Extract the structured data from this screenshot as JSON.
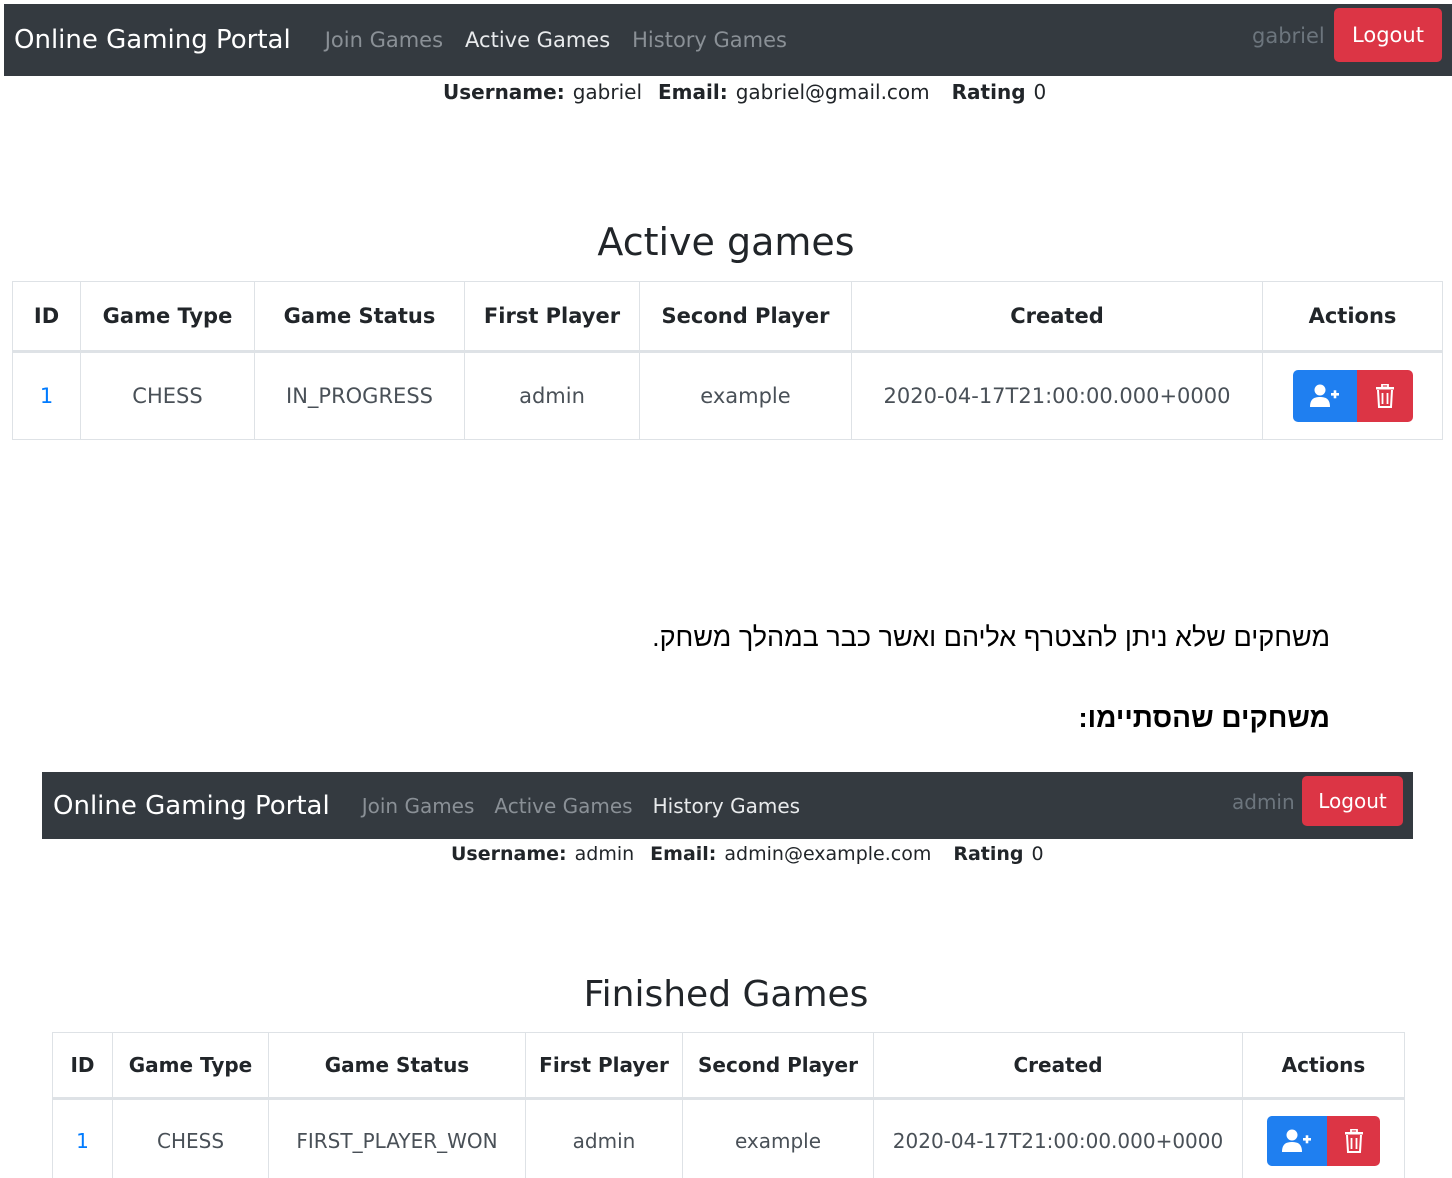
{
  "screen1": {
    "navbar": {
      "brand": "Online Gaming Portal",
      "links": [
        "Join Games",
        "Active Games",
        "History Games"
      ],
      "user": "gabriel",
      "logout": "Logout"
    },
    "profile": {
      "username_label": "Username:",
      "username": "gabriel",
      "email_label": "Email:",
      "email": "gabriel@gmail.com",
      "rating_label": "Rating",
      "rating": "0"
    },
    "heading": "Active games",
    "table": {
      "headers": [
        "ID",
        "Game Type",
        "Game Status",
        "First Player",
        "Second Player",
        "Created",
        "Actions"
      ],
      "rows": [
        {
          "id": "1",
          "type": "CHESS",
          "status": "IN_PROGRESS",
          "first": "admin",
          "second": "example",
          "created": "2020-04-17T21:00:00.000+0000"
        }
      ]
    }
  },
  "caption": "משחקים שלא ניתן להצטרף אליהם ואשר כבר במהלך משחק.",
  "section_heading": "משחקים שהסתיימו:",
  "screen2": {
    "navbar": {
      "brand": "Online Gaming Portal",
      "links": [
        "Join Games",
        "Active Games",
        "History Games"
      ],
      "user": "admin",
      "logout": "Logout"
    },
    "profile": {
      "username_label": "Username:",
      "username": "admin",
      "email_label": "Email:",
      "email": "admin@example.com",
      "rating_label": "Rating",
      "rating": "0"
    },
    "heading": "Finished Games",
    "table": {
      "headers": [
        "ID",
        "Game Type",
        "Game Status",
        "First Player",
        "Second Player",
        "Created",
        "Actions"
      ],
      "rows": [
        {
          "id": "1",
          "type": "CHESS",
          "status": "FIRST_PLAYER_WON",
          "first": "admin",
          "second": "example",
          "created": "2020-04-17T21:00:00.000+0000"
        }
      ]
    }
  },
  "colors": {
    "navbar_bg": "#343a40",
    "logout_bg": "#dc3545",
    "join_btn": "#1f7ff0",
    "link_active": "#007bff"
  },
  "icons": {
    "join": "user-plus-icon",
    "delete": "trash-icon"
  }
}
